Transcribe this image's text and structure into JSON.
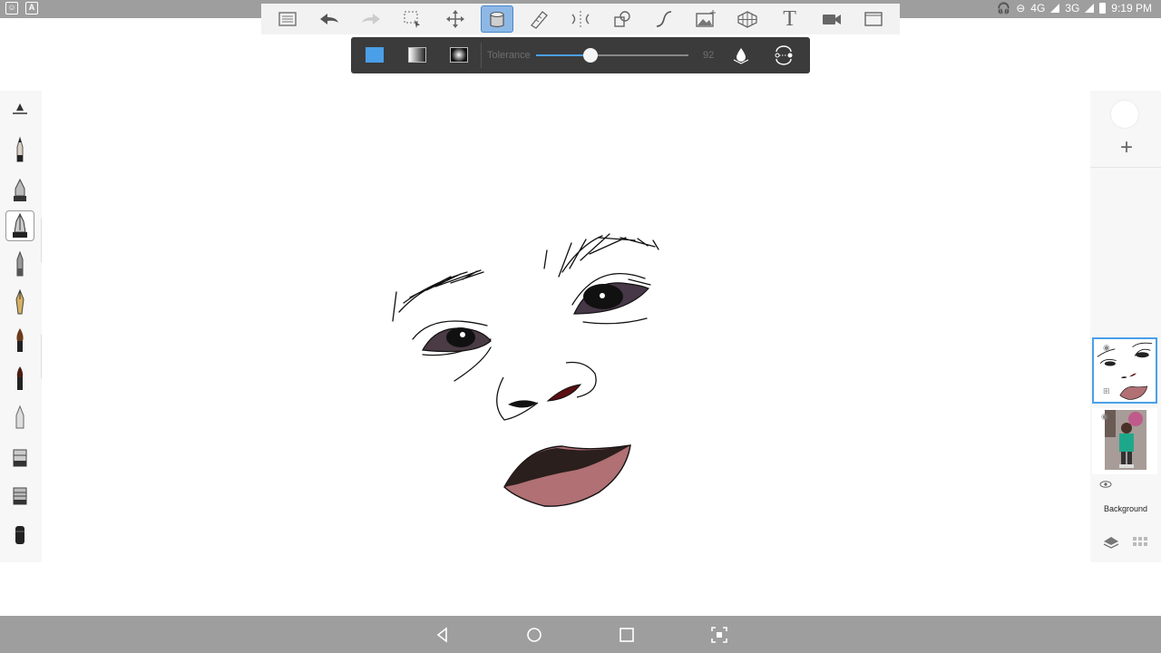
{
  "status_bar": {
    "network_4g": "4G",
    "network_3g": "3G",
    "time": "9:19 PM",
    "icons": [
      "notification-icon",
      "app-icon",
      "headphones-icon",
      "do-not-disturb-icon",
      "signal-icon",
      "battery-icon"
    ]
  },
  "toolbar": {
    "tools": [
      "layers-list-tool",
      "undo-tool",
      "redo-tool",
      "selection-tool",
      "transform-tool",
      "fill-tool",
      "ruler-tool",
      "symmetry-tool",
      "shapes-tool",
      "stroke-tool",
      "import-image-tool",
      "perspective-tool",
      "text-tool",
      "time-lapse-tool",
      "fullscreen-tool"
    ],
    "active_tool": "fill-tool",
    "text_tool_label": "T"
  },
  "fill_options": {
    "modes": [
      "solid",
      "linear-gradient",
      "radial-gradient"
    ],
    "selected_mode": "solid",
    "solid_color": "#4a9fe8",
    "tolerance_label": "Tolerance",
    "tolerance_value": "92",
    "tolerance_fraction": 0.36
  },
  "brushes": {
    "items": [
      "brush-size-slider",
      "pencil-brush",
      "ink-pen-brush",
      "marker-brush",
      "ballpoint-brush",
      "fountain-pen-brush",
      "paint-brush",
      "watercolor-brush",
      "airbrush",
      "smudge-brush",
      "textured-brush",
      "eraser-brush"
    ],
    "selected": "marker-brush"
  },
  "layers": {
    "add_label": "+",
    "active_index": 0,
    "background_label": "Background"
  },
  "colors": {
    "accent": "#4a9fe8",
    "status_bar": "#9e9e9e",
    "fill_bar": "#3b3b3b"
  },
  "nav_bar": {
    "buttons": [
      "back-button",
      "home-button",
      "recents-button",
      "screenshot-button"
    ]
  }
}
